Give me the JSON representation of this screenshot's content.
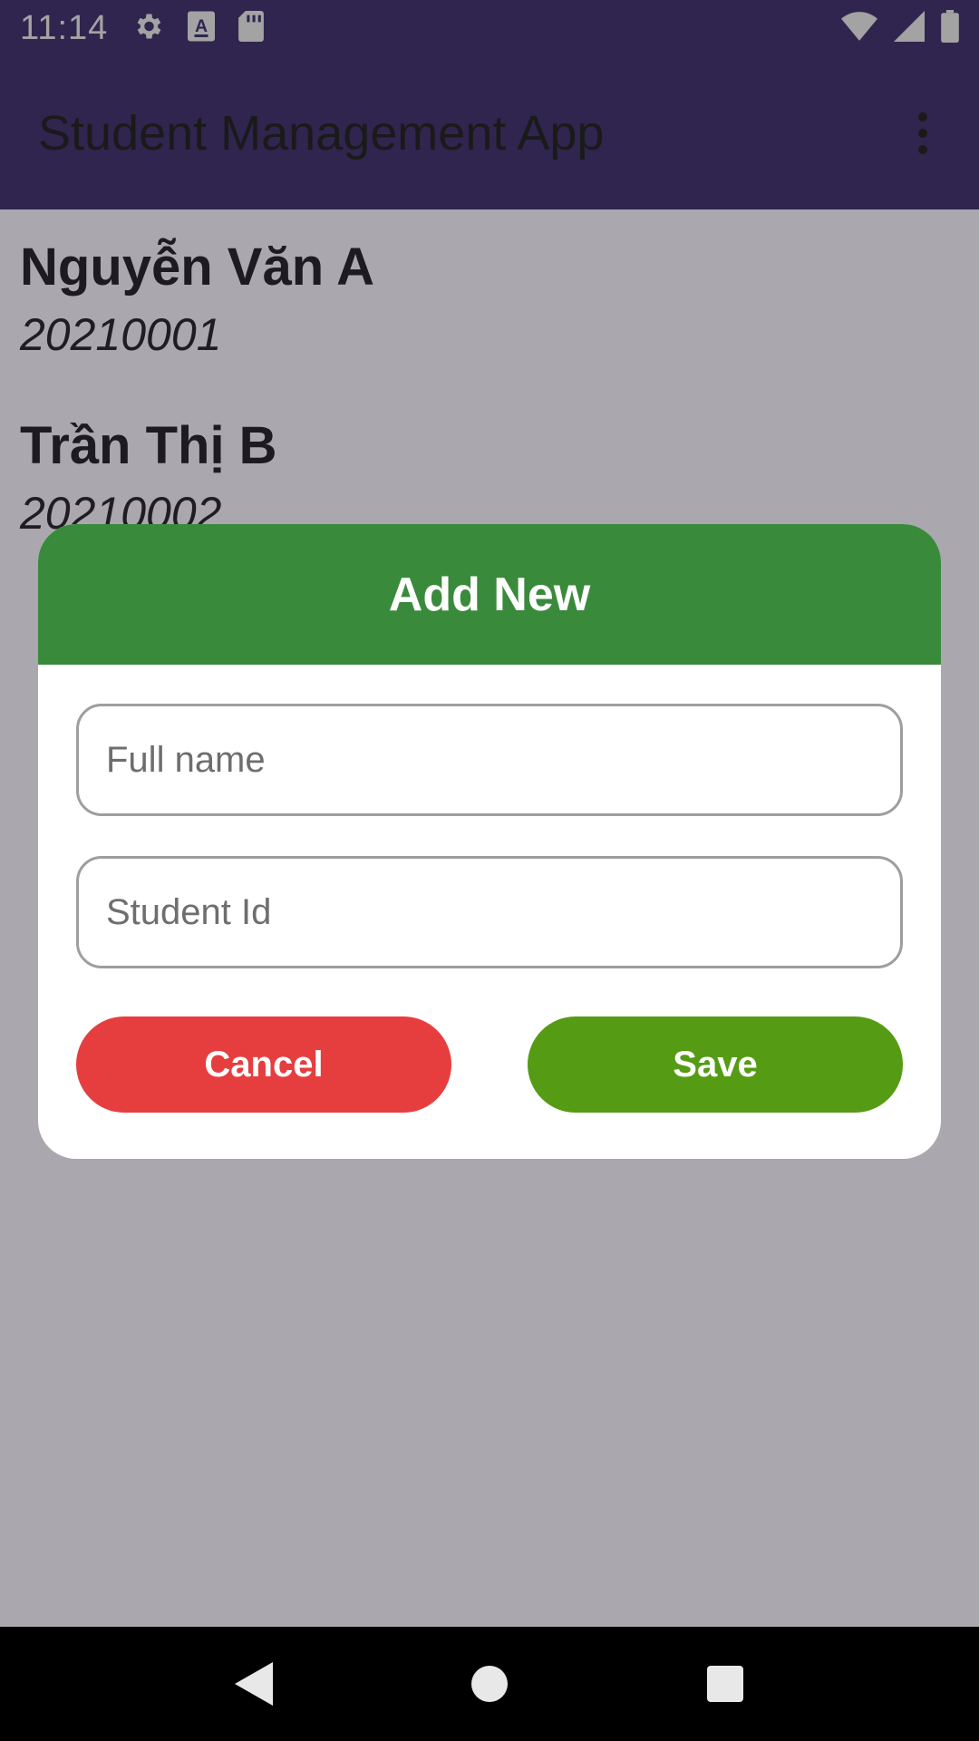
{
  "status_bar": {
    "time": "11:14",
    "icons": [
      "gear-icon",
      "text-a-icon",
      "sd-card-icon",
      "wifi-icon",
      "signal-icon",
      "battery-icon"
    ]
  },
  "app_bar": {
    "title": "Student Management App",
    "overflow_icon": "more-vert-icon"
  },
  "students": [
    {
      "name": "Nguyễn Văn A",
      "id": "20210001"
    },
    {
      "name": "Trần Thị B",
      "id": "20210002"
    }
  ],
  "dialog": {
    "title": "Add New",
    "full_name": {
      "value": "",
      "placeholder": "Full name"
    },
    "student_id": {
      "value": "",
      "placeholder": "Student Id"
    },
    "cancel_label": "Cancel",
    "save_label": "Save"
  },
  "colors": {
    "app_bar": "#4c3a7c",
    "dialog_header": "#3a8a3b",
    "cancel_button": "#e63e3f",
    "save_button": "#559b14"
  },
  "nav_bar": {
    "icons": [
      "back-icon",
      "home-icon",
      "recents-icon"
    ]
  }
}
